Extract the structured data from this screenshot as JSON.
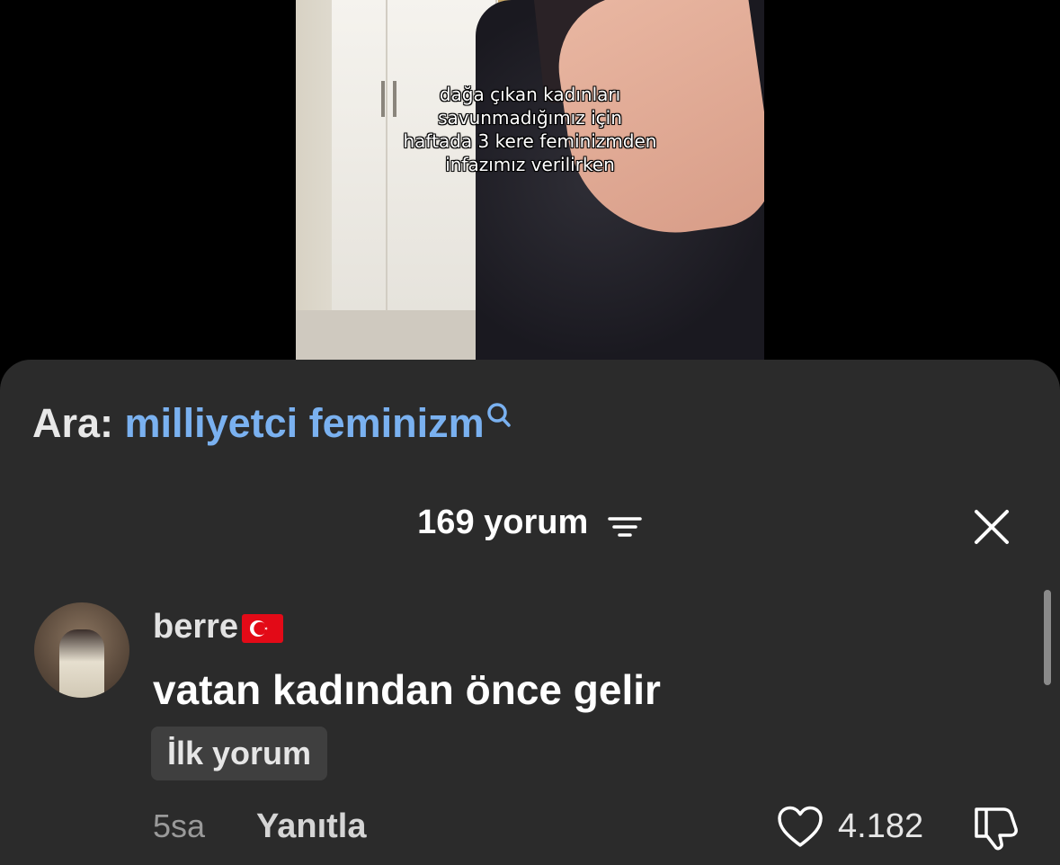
{
  "video": {
    "caption": "dağa çıkan kadınları\nsavunmadığımız için\nhaftada 3 kere feminizmden\ninfazımız verilirken"
  },
  "search": {
    "prefix": "Ara:",
    "term": "milliyetci feminizm",
    "icon": "search-icon"
  },
  "comments_header": {
    "count_label": "169 yorum",
    "filter_icon": "filter-icon",
    "close_icon": "close-icon"
  },
  "comment": {
    "username": "berre",
    "flag": "turkey-flag",
    "text": "vatan kadından önce gelir",
    "badge": "İlk yorum",
    "time": "5sa",
    "reply_label": "Yanıtla",
    "like_count": "4.182"
  },
  "colors": {
    "sheet_bg": "#2b2b2b",
    "link_blue": "#7ab1f0",
    "flag_red": "#e30a17"
  }
}
